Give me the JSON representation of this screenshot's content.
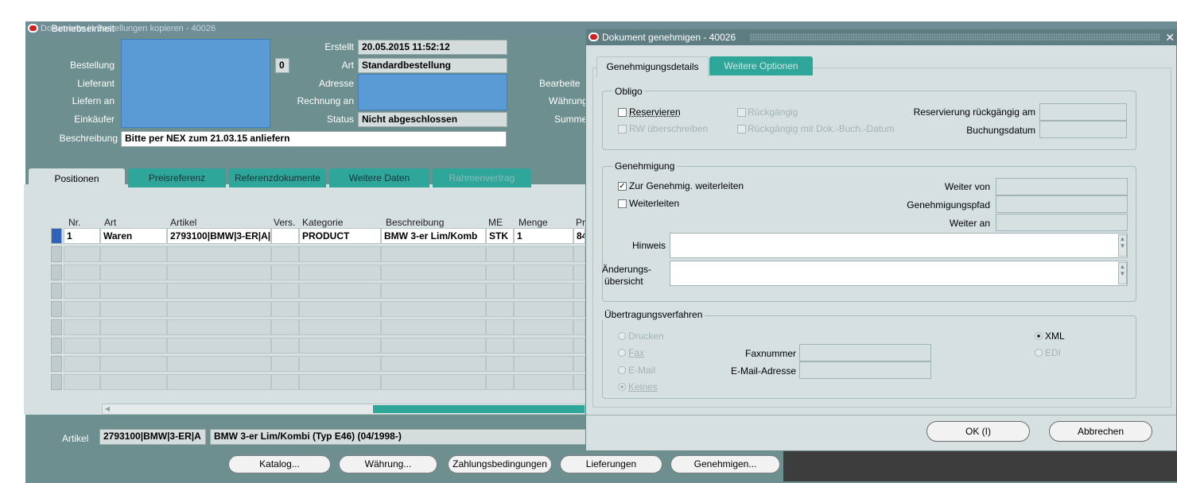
{
  "main": {
    "title": "Dokumente in Bestellungen kopieren - 40026",
    "header": {
      "betriebseinheit_label": "Betriebseinheit",
      "bestellung_label": "Bestellung",
      "bestellung_rev": "0",
      "lieferant_label": "Lieferant",
      "liefern_an_label": "Liefern an",
      "einkaeufer_label": "Einkäufer",
      "beschreibung_label": "Beschreibung",
      "beschreibung_value": "Bitte per NEX zum 21.03.15 anliefern",
      "erstellt_label": "Erstellt",
      "erstellt_value": "20.05.2015 11:52:12",
      "art_label": "Art",
      "art_value": "Standardbestellung",
      "adresse_label": "Adresse",
      "rechnung_an_label": "Rechnung an",
      "status_label": "Status",
      "status_value": "Nicht abgeschlossen",
      "bearbeiter_label": "Bearbeite",
      "waehrung_label": "Währung",
      "summe_label": "Summe"
    },
    "tabs": [
      {
        "label": "Positionen"
      },
      {
        "label": "Preisreferenz"
      },
      {
        "label": "Referenzdokumente"
      },
      {
        "label": "Weitere Daten"
      },
      {
        "label": "Rahmenvertrag"
      }
    ],
    "table": {
      "headers": [
        "Nr.",
        "Art",
        "Artikel",
        "Vers.",
        "Kategorie",
        "Beschreibung",
        "ME",
        "Menge",
        "Pr"
      ],
      "row1": [
        "1",
        "Waren",
        "2793100|BMW|3-ER|A|",
        "",
        "PRODUCT",
        "BMW 3-er Lim/Komb",
        "STK",
        "1",
        "84"
      ]
    },
    "footer": {
      "artikel_label": "Artikel",
      "artikel_value": "2793100|BMW|3-ER|A",
      "artikel_desc": "BMW 3-er Lim/Kombi (Typ E46) (04/1998-)"
    },
    "buttons": [
      "Katalog...",
      "Währung...",
      "Zahlungsbedingungen",
      "Lieferungen",
      "Genehmigen..."
    ]
  },
  "dialog": {
    "title": "Dokument genehmigen - 40026",
    "tabs": [
      {
        "label": "Genehmigungsdetails"
      },
      {
        "label": "Weitere Optionen"
      }
    ],
    "obligo": {
      "title": "Obligo",
      "reservieren": "Reservieren",
      "rueckgaengig": "Rückgängig",
      "reservierung_rueckgaengig_am": "Reservierung rückgängig am",
      "rw_ueberschreiben": "RW überschreiben",
      "rueckgaengig_mit_dok": "Rückgängig mit Dok.-Buch.-Datum",
      "buchungsdatum": "Buchungsdatum"
    },
    "genehmigung": {
      "title": "Genehmigung",
      "zur_genehmigung": "Zur Genehmig. weiterleiten",
      "weiterleiten": "Weiterleiten",
      "weiter_von": "Weiter von",
      "genehmigungspfad": "Genehmigungspfad",
      "weiter_an": "Weiter an",
      "hinweis": "Hinweis",
      "aenderungs_line1": "Änderungs-",
      "aenderungs_line2": "übersicht"
    },
    "uebertragung": {
      "title": "Übertragungsverfahren",
      "drucken": "Drucken",
      "fax": "Fax",
      "email": "E-Mail",
      "keines": "Keines",
      "faxnummer": "Faxnummer",
      "email_adresse": "E-Mail-Adresse",
      "xml": "XML",
      "edi": "EDI"
    },
    "ok_label": "OK (I)",
    "abbrechen_label": "Abbrechen"
  },
  "colors": {
    "window_bg": "#6d8f8f",
    "tab_teal": "#2fa69a",
    "panel_bg": "#d6e0e0",
    "field_blue": "#5b9bd5",
    "oracle_red": "#d3201d"
  }
}
